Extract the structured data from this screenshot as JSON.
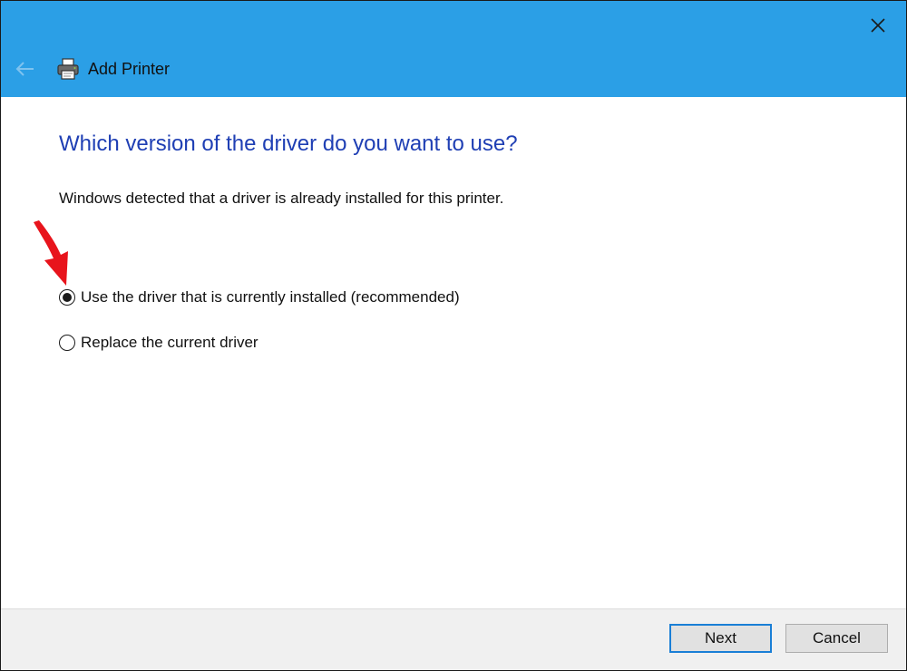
{
  "window": {
    "title": "Add Printer"
  },
  "content": {
    "heading": "Which version of the driver do you want to use?",
    "description": "Windows detected that a driver is already installed for this printer.",
    "options": [
      {
        "label": "Use the driver that is currently installed (recommended)",
        "selected": true
      },
      {
        "label": "Replace the current driver",
        "selected": false
      }
    ]
  },
  "footer": {
    "next_label": "Next",
    "cancel_label": "Cancel"
  },
  "colors": {
    "titlebar": "#2b9fe6",
    "heading": "#1f3fb4",
    "arrow": "#e8141c",
    "default_button_border": "#1a7fd6"
  }
}
